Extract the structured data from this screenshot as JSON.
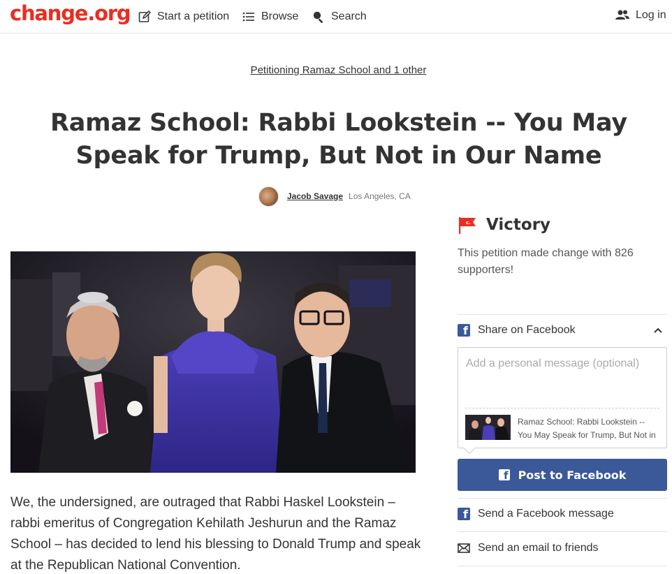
{
  "header": {
    "logo": "change.org",
    "nav": {
      "start": "Start a petition",
      "browse": "Browse",
      "search": "Search",
      "login": "Log in"
    }
  },
  "petition": {
    "petitioning": "Petitioning Ramaz School and 1 other",
    "title": "Ramaz School: Rabbi Lookstein -- You May Speak for Trump, But Not in Our Name",
    "author_name": "Jacob Savage",
    "author_location": "Los Angeles, CA",
    "body": "We, the undersigned, are outraged that Rabbi Haskel Lookstein – rabbi emeritus of Congregation Kehilath Jeshurun and the Ramaz School – has decided to lend his blessing to Donald Trump and speak at the Republican National Convention."
  },
  "sidebar": {
    "victory_title": "Victory",
    "victory_desc": "This petition made change with 826 supporters!",
    "share_facebook": "Share on Facebook",
    "message_placeholder": "Add a personal message (optional)",
    "preview_text": "Ramaz School: Rabbi Lookstein -- You May Speak for Trump, But Not in Our Name",
    "post_button": "Post to Facebook",
    "send_fb_message": "Send a Facebook message",
    "send_email": "Send an email to friends"
  },
  "colors": {
    "brand": "#ec2c22",
    "facebook": "#3b5998"
  }
}
